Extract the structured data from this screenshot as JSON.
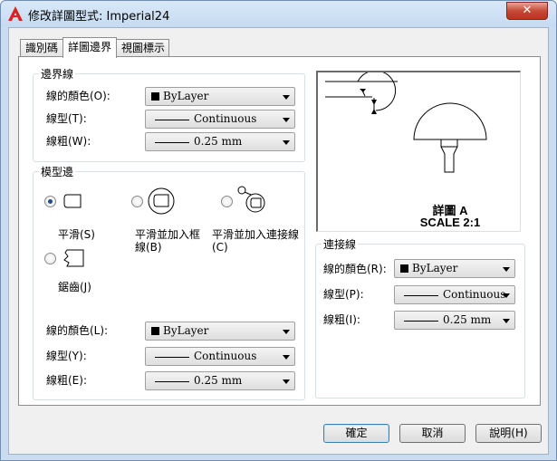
{
  "window": {
    "title": "修改詳圖型式: Imperial24",
    "close": "✕"
  },
  "tabs": [
    "識別碼",
    "詳圖邊界",
    "視圖標示"
  ],
  "boundary": {
    "title": "邊界線",
    "color_label": "線的顏色(O):",
    "linetype_label": "線型(T):",
    "lineweight_label": "線粗(W):",
    "color_value": "ByLayer",
    "linetype_value": "Continuous",
    "lineweight_value": "0.25 mm"
  },
  "model_edge": {
    "title": "模型邊",
    "options": [
      {
        "label": "平滑(S)",
        "checked": true
      },
      {
        "label": "平滑並加入框線(B)",
        "checked": false
      },
      {
        "label": "平滑並加入連接線(C)",
        "checked": false
      },
      {
        "label": "鋸齒(J)",
        "checked": false
      }
    ],
    "color_label": "線的顏色(L):",
    "linetype_label": "線型(Y):",
    "lineweight_label": "線粗(E):",
    "color_value": "ByLayer",
    "linetype_value": "Continuous",
    "lineweight_value": "0.25 mm"
  },
  "preview": {
    "line1": "詳圖 A",
    "line2": "SCALE 2:1"
  },
  "connection": {
    "title": "連接線",
    "color_label": "線的顏色(R):",
    "linetype_label": "線型(P):",
    "lineweight_label": "線粗(I):",
    "color_value": "ByLayer",
    "linetype_value": "Continuous",
    "lineweight_value": "0.25 mm"
  },
  "buttons": {
    "ok": "確定",
    "cancel": "取消",
    "help": "說明(H)"
  },
  "icons": {
    "app": "autocad-icon",
    "close": "close-icon"
  }
}
